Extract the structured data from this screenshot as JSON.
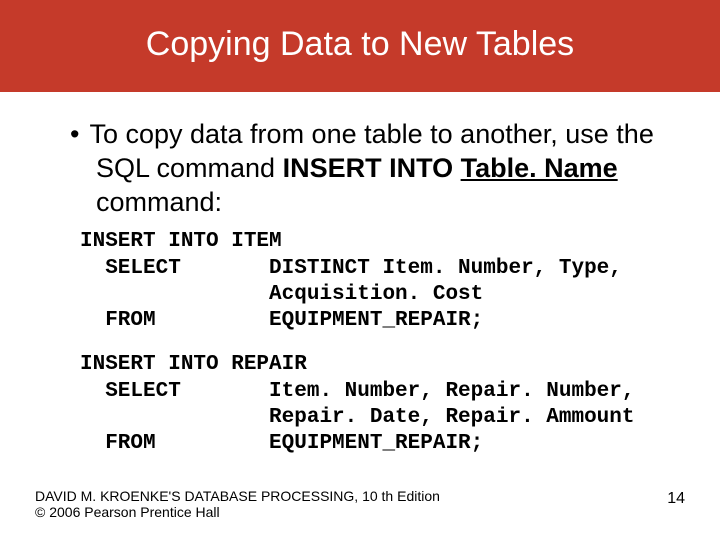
{
  "title": "Copying Data to New Tables",
  "bullet_intro": "To copy data from one table to another, use the SQL command ",
  "bullet_bold1": "INSERT INTO ",
  "bullet_bold2_underlined": "Table. Name",
  "bullet_bold3": " command:",
  "code1": {
    "l1": "INSERT INTO ITEM",
    "l2": "  SELECT       DISTINCT Item. Number, Type,",
    "l3": "               Acquisition. Cost",
    "l4": "  FROM         EQUIPMENT_REPAIR;"
  },
  "code2": {
    "l1": "INSERT INTO REPAIR",
    "l2": "  SELECT       Item. Number, Repair. Number,",
    "l3": "               Repair. Date, Repair. Ammount",
    "l4": "  FROM         EQUIPMENT_REPAIR;"
  },
  "footer": {
    "line1": "DAVID M. KROENKE'S DATABASE PROCESSING, 10 th Edition",
    "line2": "© 2006 Pearson Prentice Hall",
    "page": "14"
  }
}
